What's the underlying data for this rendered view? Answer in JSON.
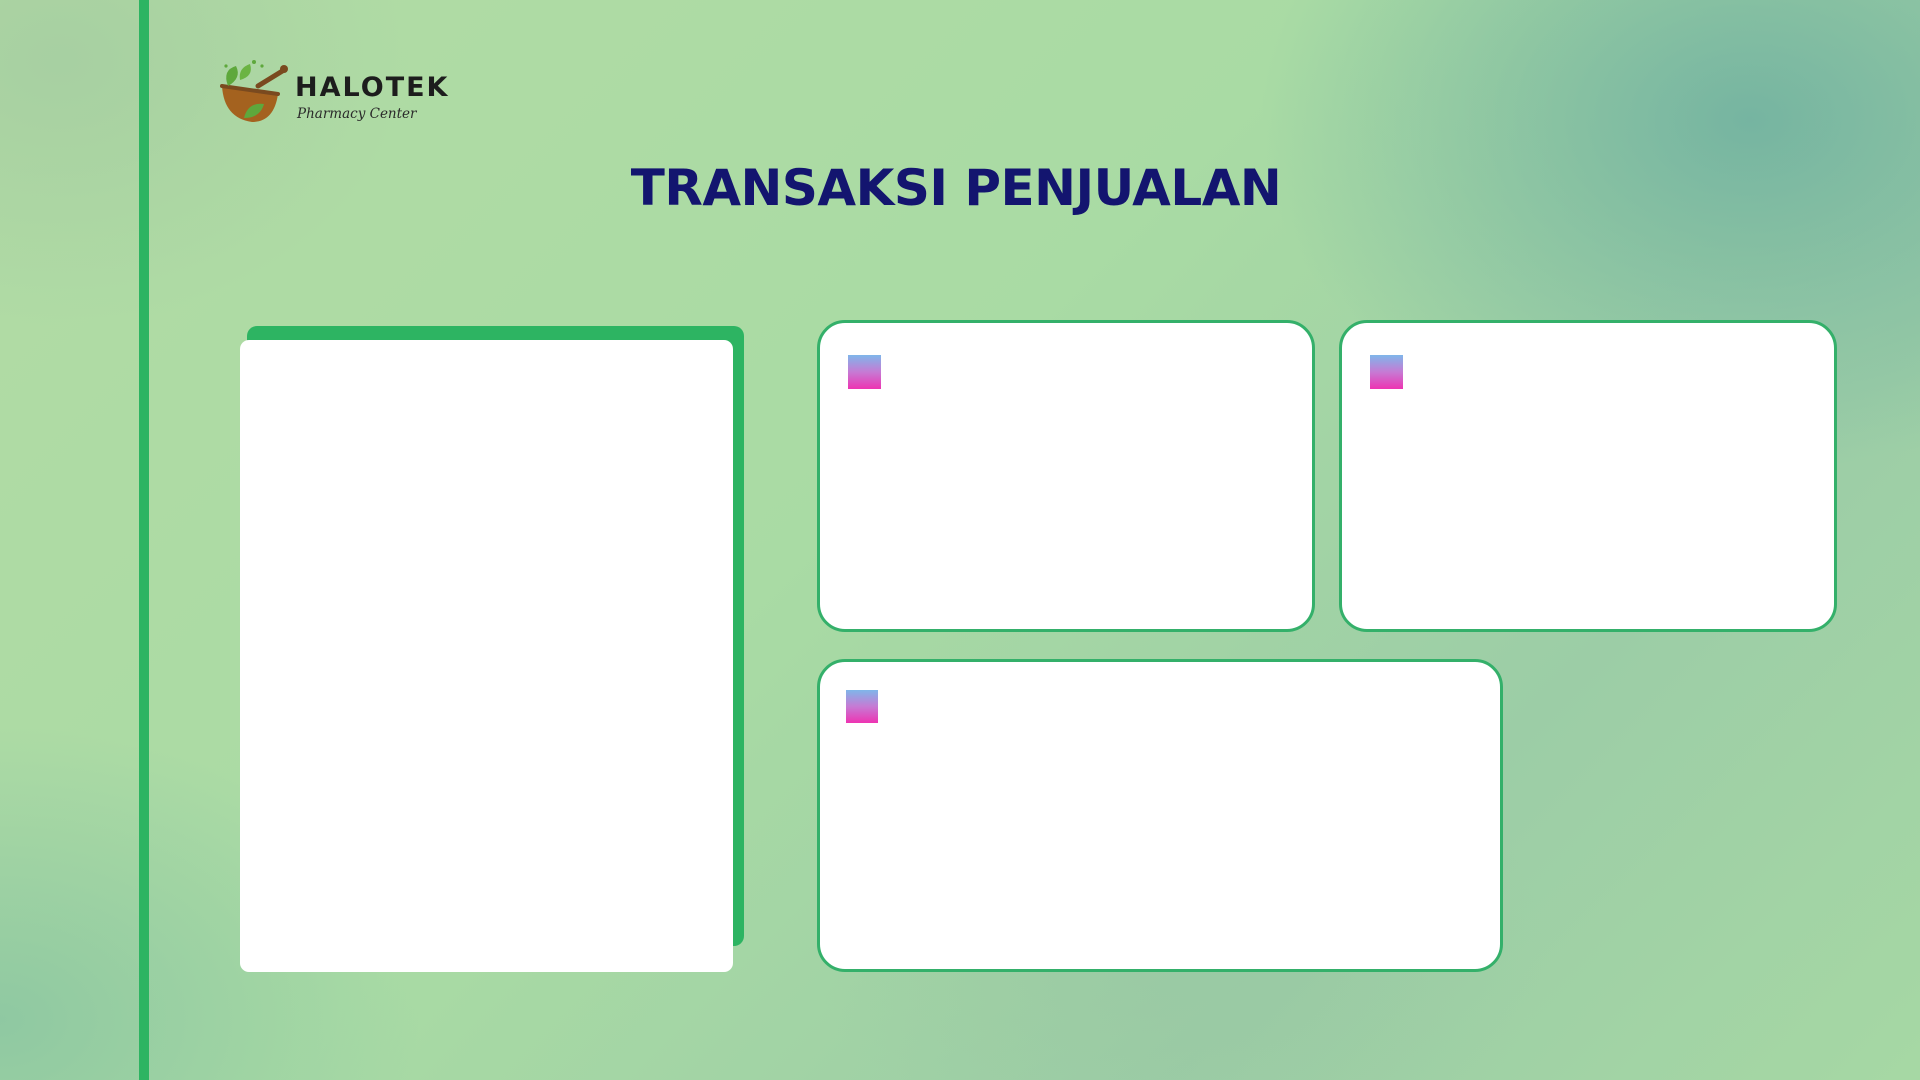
{
  "brand": {
    "name": "HALOTEK",
    "tagline": "Pharmacy Center",
    "logo_icon": "mortar-pestle-leaf-icon"
  },
  "page": {
    "title": "TRANSAKSI PENJUALAN"
  },
  "panels": [
    {
      "id": "left-panel",
      "content": ""
    },
    {
      "id": "card-a",
      "icon": "gradient-square-icon"
    },
    {
      "id": "card-b",
      "icon": "gradient-square-icon"
    },
    {
      "id": "card-c",
      "icon": "gradient-square-icon"
    }
  ],
  "colors": {
    "accent_green": "#2db462",
    "card_border": "#34b06a",
    "title_navy": "#13156f",
    "icon_gradient": [
      "#7fb6ea",
      "#ee34b2"
    ]
  }
}
